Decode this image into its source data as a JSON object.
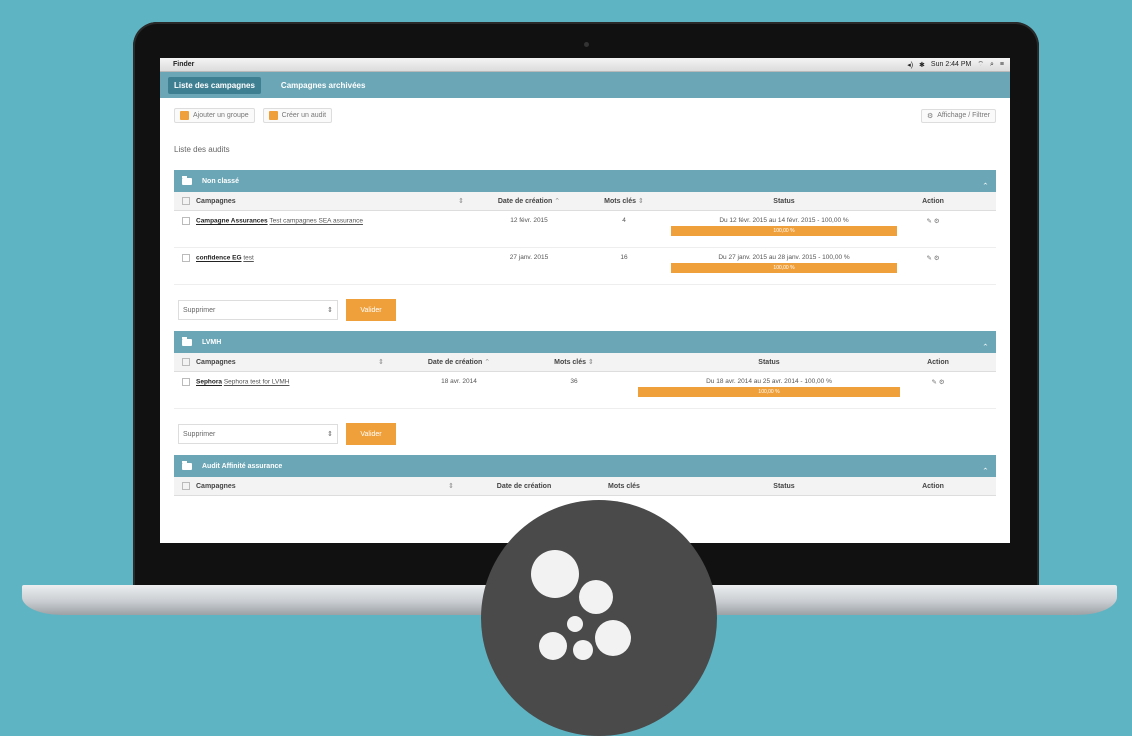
{
  "menubar": {
    "app": "Finder",
    "clock": "Sun 2:44 PM"
  },
  "tabs": [
    {
      "label": "Liste des campagnes",
      "active": true
    },
    {
      "label": "Campagnes archivées",
      "active": false
    }
  ],
  "toolbar": {
    "add_group": "Ajouter un groupe",
    "create_audit": "Créer un audit",
    "display": "Affichage / Filtrer"
  },
  "subtitle": "Liste des audits",
  "columns": {
    "campaign": "Campagnes",
    "date": "Date de création",
    "keywords": "Mots clés",
    "status": "Status",
    "action": "Action"
  },
  "footer": {
    "select_value": "Supprimer",
    "validate": "Valider"
  },
  "groups": [
    {
      "name": "Non classé",
      "rows": [
        {
          "campaign": "Campagne Assurances",
          "detail": "Test campagnes SEA assurance",
          "date": "12 févr. 2015",
          "keywords": "4",
          "status": "Du 12 févr. 2015 au 14 févr. 2015 - 100,00 %",
          "progress": "100,00 %"
        },
        {
          "campaign": "confidence EG",
          "detail": "test",
          "date": "27 janv. 2015",
          "keywords": "16",
          "status": "Du 27 janv. 2015 au 28 janv. 2015 - 100,00 %",
          "progress": "100,00 %"
        }
      ]
    },
    {
      "name": "LVMH",
      "rows": [
        {
          "campaign": "Sephora",
          "detail": "Sephora test for LVMH",
          "date": "18 avr. 2014",
          "keywords": "36",
          "status": "Du 18 avr. 2014 au 25 avr. 2014 - 100,00 %",
          "progress": "100,00 %"
        }
      ]
    },
    {
      "name": "Audit Affinité assurance",
      "rows": []
    }
  ],
  "colors": {
    "background": "#5fb4c3",
    "teal": "#6aa6b6",
    "orange": "#f0a03a",
    "logo": "#4a4a4a"
  }
}
